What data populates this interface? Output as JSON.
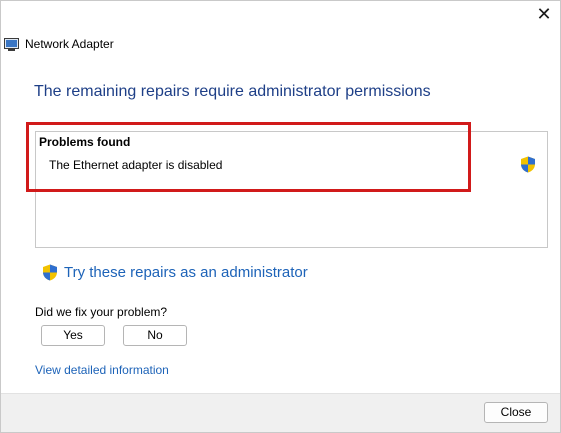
{
  "window": {
    "title": "Network Adapter",
    "close_glyph": "✕"
  },
  "heading": "The remaining repairs require administrator permissions",
  "problems": {
    "title": "Problems found",
    "items": [
      {
        "label": "The Ethernet adapter is disabled",
        "icon": "uac-shield-icon"
      }
    ]
  },
  "admin_repair": {
    "label": "Try these repairs as an administrator",
    "icon": "uac-shield-icon"
  },
  "feedback": {
    "question": "Did we fix your problem?",
    "yes_label": "Yes",
    "no_label": "No"
  },
  "detail_link": "View detailed information",
  "footer": {
    "close_label": "Close"
  },
  "colors": {
    "heading": "#1e3f87",
    "link": "#1d63b8",
    "highlight": "#d11a1a",
    "footer_bg": "#f0f0f0"
  }
}
